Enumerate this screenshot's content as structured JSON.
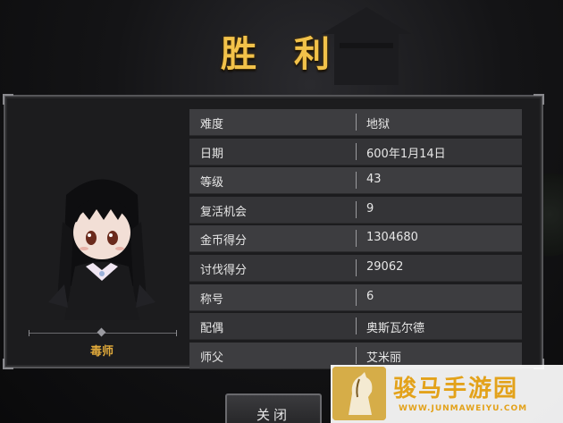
{
  "screen": {
    "title": "胜 利",
    "close_label": "关闭"
  },
  "character": {
    "name": "毒师"
  },
  "stats": [
    {
      "label": "难度",
      "value": "地狱"
    },
    {
      "label": "日期",
      "value": "600年1月14日"
    },
    {
      "label": "等级",
      "value": "43"
    },
    {
      "label": "复活机会",
      "value": "9"
    },
    {
      "label": "金币得分",
      "value": "1304680"
    },
    {
      "label": "讨伐得分",
      "value": "29062"
    },
    {
      "label": "称号",
      "value": "6"
    },
    {
      "label": "配偶",
      "value": "奥斯瓦尔德"
    },
    {
      "label": "师父",
      "value": "艾米丽"
    }
  ],
  "watermark": {
    "title": "骏马手游园",
    "url": "WWW.JUNMAWEIYU.COM"
  },
  "colors": {
    "title_gold": "#f2c24a",
    "name_gold": "#e0a93b",
    "watermark_orange": "#e3a21a"
  }
}
